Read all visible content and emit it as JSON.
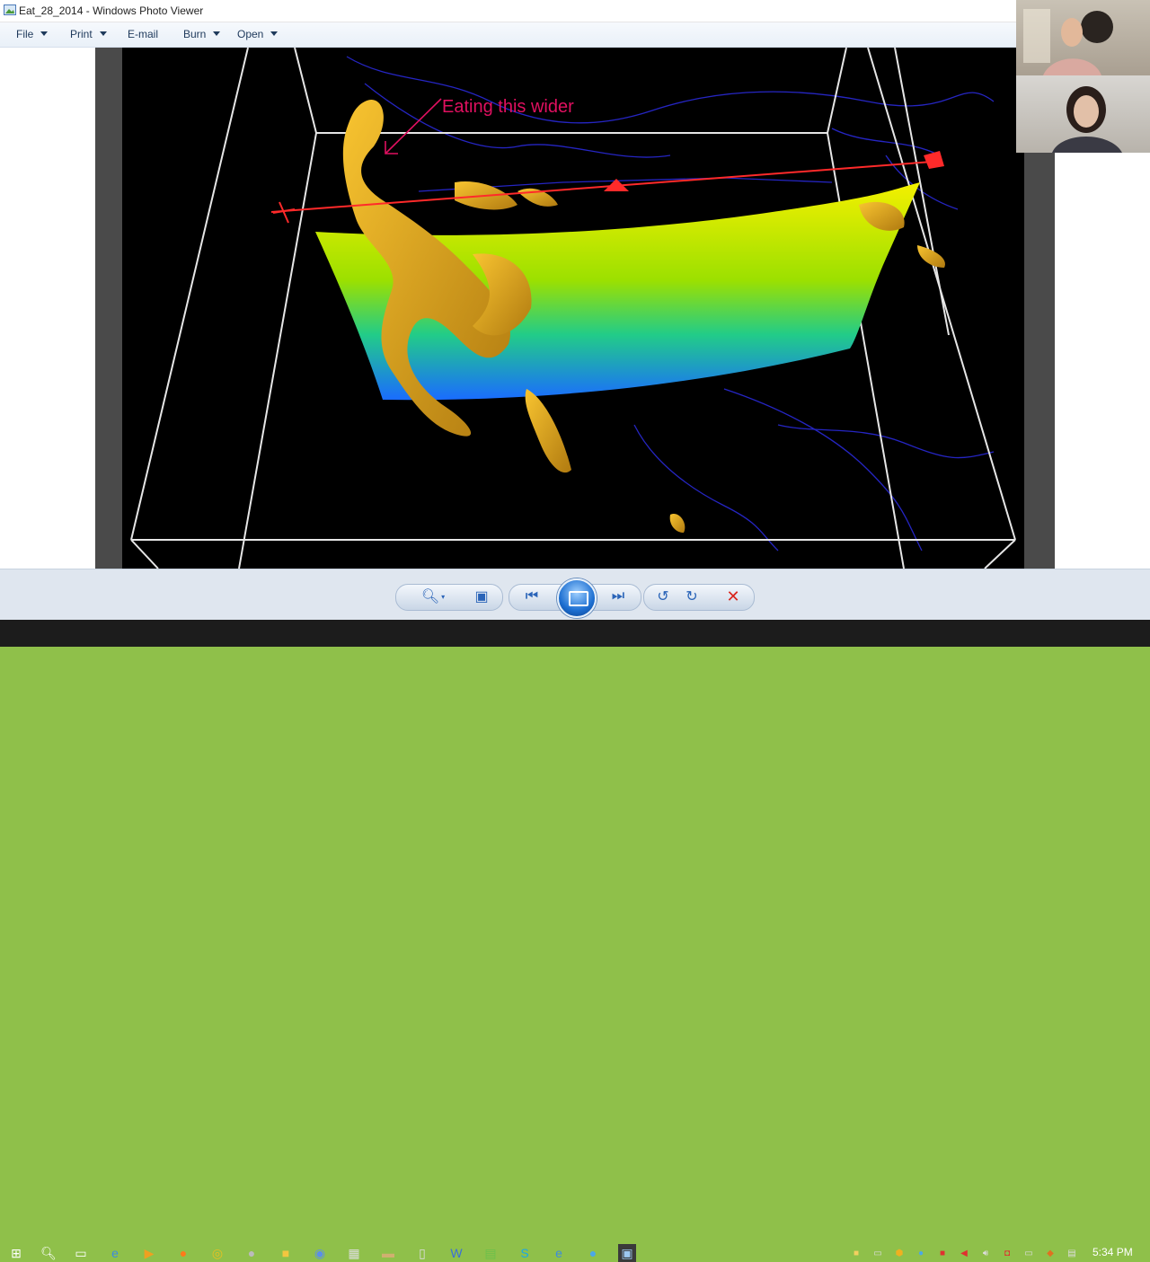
{
  "window": {
    "title": "Eat_28_2014 - Windows Photo Viewer"
  },
  "menu": {
    "file": "File",
    "print": "Print",
    "email": "E-mail",
    "burn": "Burn",
    "open": "Open"
  },
  "image": {
    "annotation": "Eating this wider"
  },
  "taskbar": {
    "time": "5:34 PM"
  },
  "colors": {
    "accent_blue": "#2a64b8",
    "annotation_pink": "#e01060",
    "close_red": "#d9251c",
    "desktop_green": "#8fc04a"
  },
  "icons": {
    "app": "photo-viewer-icon",
    "zoom": "zoom-icon",
    "fit": "actual-size-icon",
    "previous": "previous-icon",
    "slideshow": "slideshow-icon",
    "next": "next-icon",
    "rotate_left": "rotate-counterclockwise-icon",
    "rotate_right": "rotate-clockwise-icon",
    "delete": "delete-icon"
  }
}
